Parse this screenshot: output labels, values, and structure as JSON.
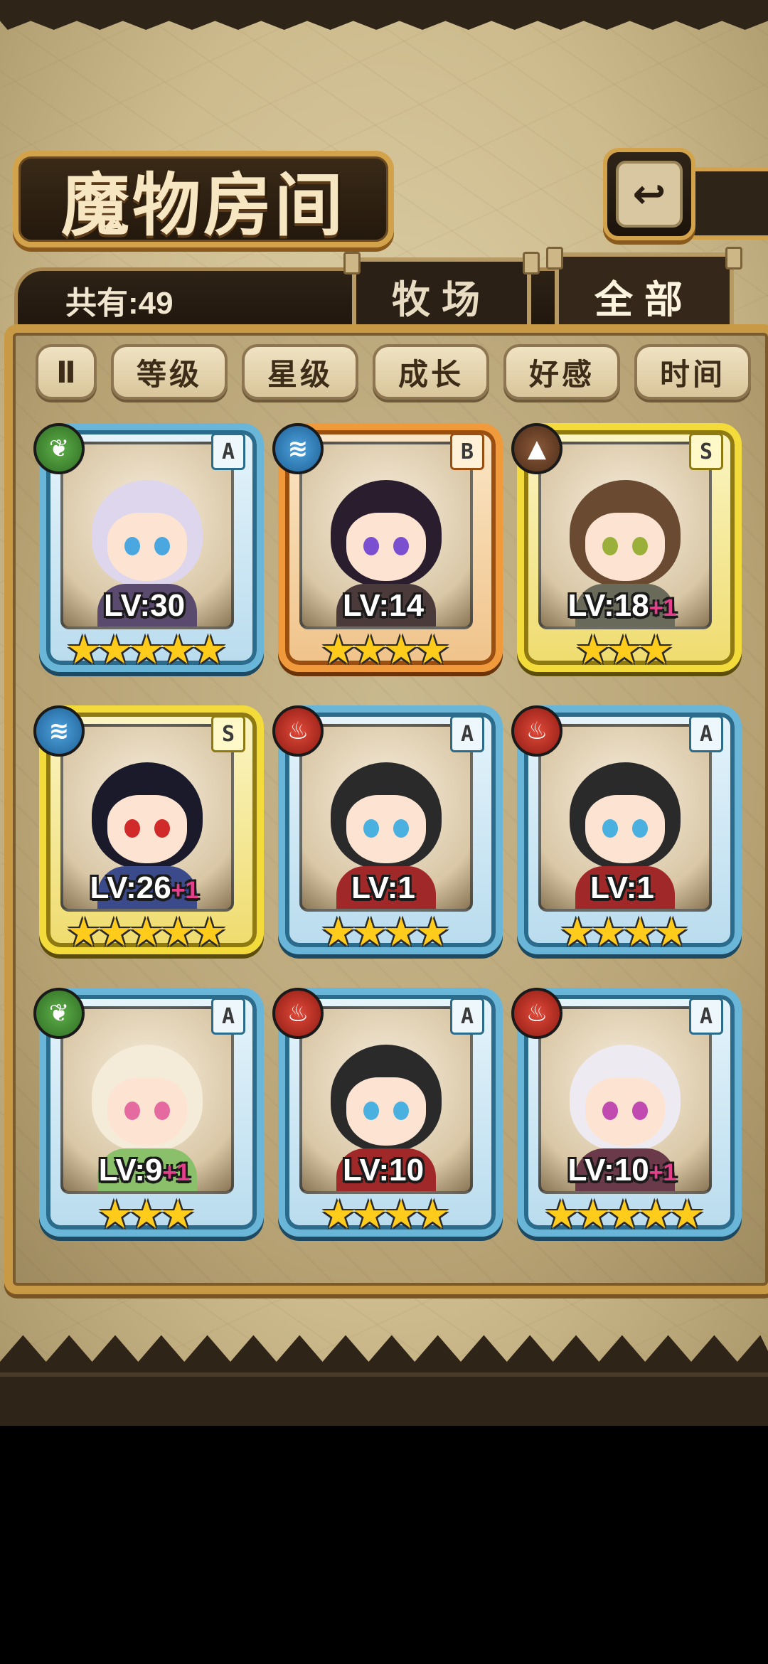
{
  "title": "魔物房间",
  "back_icon": "↩",
  "count_label": "共有:49",
  "tabs": {
    "ranch": "牧场",
    "all": "全部"
  },
  "sort_icon": "Ⅱ",
  "filters": [
    "等级",
    "星级",
    "成长",
    "好感",
    "时间"
  ],
  "cards": [
    {
      "element": "leaf",
      "element_glyph": "❦",
      "rank": "A",
      "level": "LV:30",
      "plus": "",
      "stars": "★★★★★",
      "hair": "#ddd6ec",
      "eye": "#4aa7e0",
      "outfit": "#5a4a6e"
    },
    {
      "element": "water",
      "element_glyph": "≋",
      "rank": "B",
      "level": "LV:14",
      "plus": "",
      "stars": "★★★★",
      "hair": "#2a1e2e",
      "eye": "#7b4fd0",
      "outfit": "#4a3a3a"
    },
    {
      "element": "earth",
      "element_glyph": "▲",
      "rank": "S",
      "level": "LV:18",
      "plus": "+1",
      "stars": "★★★",
      "hair": "#6a4a30",
      "eye": "#9bb03a",
      "outfit": "#6a6a5a"
    },
    {
      "element": "water",
      "element_glyph": "≋",
      "rank": "S",
      "level": "LV:26",
      "plus": "+1",
      "stars": "★★★★★",
      "hair": "#1a1a2a",
      "eye": "#d02a2a",
      "outfit": "#3a4a8a"
    },
    {
      "element": "fire",
      "element_glyph": "♨",
      "rank": "A",
      "level": "LV:1",
      "plus": "",
      "stars": "★★★★",
      "hair": "#2a2a2a",
      "eye": "#4ab0e0",
      "outfit": "#a02828"
    },
    {
      "element": "fire",
      "element_glyph": "♨",
      "rank": "A",
      "level": "LV:1",
      "plus": "",
      "stars": "★★★★",
      "hair": "#2a2a2a",
      "eye": "#4ab0e0",
      "outfit": "#a02828"
    },
    {
      "element": "leaf",
      "element_glyph": "❦",
      "rank": "A",
      "level": "LV:9",
      "plus": "+1",
      "stars": "★★★",
      "hair": "#f4ecd8",
      "eye": "#e46aa0",
      "outfit": "#8ac06a"
    },
    {
      "element": "fire",
      "element_glyph": "♨",
      "rank": "A",
      "level": "LV:10",
      "plus": "",
      "stars": "★★★★",
      "hair": "#2a2a2a",
      "eye": "#4ab0e0",
      "outfit": "#a02828"
    },
    {
      "element": "fire",
      "element_glyph": "♨",
      "rank": "A",
      "level": "LV:10",
      "plus": "+1",
      "stars": "★★★★★",
      "hair": "#eeeaf2",
      "eye": "#c04ab0",
      "outfit": "#6a3a4a"
    }
  ]
}
